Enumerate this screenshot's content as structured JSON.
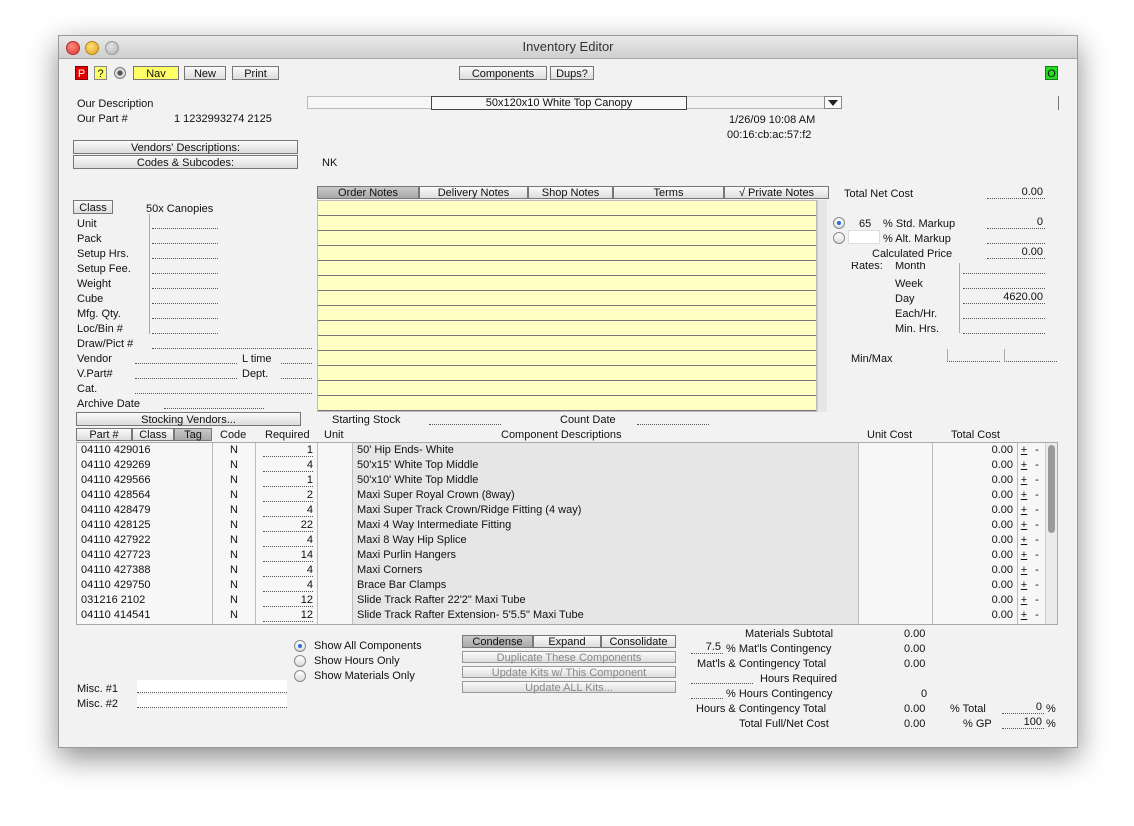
{
  "window": {
    "title": "Inventory Editor"
  },
  "toolbar": {
    "p": "P",
    "q": "?",
    "nav": "Nav",
    "new": "New",
    "print": "Print",
    "components": "Components",
    "dups": "Dups?",
    "status": "O"
  },
  "header": {
    "our_description_label": "Our Description",
    "our_part_label": "Our Part #",
    "our_part_value": "1 1232993274 2125",
    "description_value": "50x120x10 White Top Canopy",
    "date": "1/26/09 10:08 AM",
    "mac": "00:16:cb:ac:57:f2",
    "vendors_desc_button": "Vendors' Descriptions:",
    "codes_button": "Codes & Subcodes:",
    "codes_value": "NK"
  },
  "left": {
    "class_button": "Class",
    "class_value": "50x Canopies",
    "unit": "Unit",
    "pack": "Pack",
    "setup_hrs": "Setup Hrs.",
    "setup_fee": "Setup Fee.",
    "weight": "Weight",
    "cube": "Cube",
    "mfg_qty": "Mfg. Qty.",
    "loc_bin": "Loc/Bin #",
    "draw_pict": "Draw/Pict #",
    "vendor": "Vendor",
    "l_time": "L time",
    "v_part": "V.Part#",
    "dept": "Dept.",
    "cat": "Cat.",
    "archive_date": "Archive Date",
    "stocking_vendors": "Stocking Vendors..."
  },
  "notes": {
    "tabs": [
      "Order Notes",
      "Delivery Notes",
      "Shop Notes",
      "Terms",
      "√ Private Notes"
    ],
    "starting_stock": "Starting Stock",
    "count_date": "Count Date"
  },
  "pricing": {
    "total_net_cost_label": "Total Net Cost",
    "total_net_cost": "0.00",
    "std_markup_pct": "65",
    "std_markup_label": "% Std. Markup",
    "std_markup_value": "0",
    "alt_markup_label": "% Alt. Markup",
    "calc_price_label": "Calculated Price",
    "calc_price": "0.00",
    "rates_label": "Rates:",
    "month": "Month",
    "week": "Week",
    "day": "Day",
    "day_value": "4620.00",
    "each_hr": "Each/Hr.",
    "min_hrs": "Min. Hrs.",
    "min_max": "Min/Max"
  },
  "table": {
    "headers": {
      "part": "Part #",
      "class": "Class",
      "tag": "Tag",
      "code": "Code",
      "required": "Required",
      "unit": "Unit",
      "desc": "Component Descriptions",
      "unit_cost": "Unit Cost",
      "total_cost": "Total Cost"
    },
    "rows": [
      {
        "part": "04110 429016",
        "code": "N",
        "required": "1",
        "desc": "50' Hip Ends- White",
        "total": "0.00"
      },
      {
        "part": "04110 429269",
        "code": "N",
        "required": "4",
        "desc": "50'x15' White Top Middle",
        "total": "0.00"
      },
      {
        "part": "04110 429566",
        "code": "N",
        "required": "1",
        "desc": "50'x10' White Top Middle",
        "total": "0.00"
      },
      {
        "part": "04110 428564",
        "code": "N",
        "required": "2",
        "desc": "Maxi Super Royal Crown (8way)",
        "total": "0.00"
      },
      {
        "part": "04110 428479",
        "code": "N",
        "required": "4",
        "desc": "Maxi Super Track Crown/Ridge Fitting (4 way)",
        "total": "0.00"
      },
      {
        "part": "04110 428125",
        "code": "N",
        "required": "22",
        "desc": "Maxi 4 Way Intermediate Fitting",
        "total": "0.00"
      },
      {
        "part": "04110 427922",
        "code": "N",
        "required": "4",
        "desc": "Maxi 8 Way Hip Splice",
        "total": "0.00"
      },
      {
        "part": "04110 427723",
        "code": "N",
        "required": "14",
        "desc": "Maxi Purlin Hangers",
        "total": "0.00"
      },
      {
        "part": "04110 427388",
        "code": "N",
        "required": "4",
        "desc": "Maxi Corners",
        "total": "0.00"
      },
      {
        "part": "04110 429750",
        "code": "N",
        "required": "4",
        "desc": "Brace Bar Clamps",
        "total": "0.00"
      },
      {
        "part": "031216 2102",
        "code": "N",
        "required": "12",
        "desc": "Slide Track Rafter 22'2\" Maxi Tube",
        "total": "0.00"
      },
      {
        "part": "04110 414541",
        "code": "N",
        "required": "12",
        "desc": "Slide Track Rafter Extension- 5'5.5\" Maxi Tube",
        "total": "0.00"
      }
    ],
    "plus": "+",
    "minus": "-"
  },
  "bottom": {
    "show_all": "Show All Components",
    "show_hours": "Show Hours Only",
    "show_materials": "Show Materials Only",
    "condense": "Condense",
    "expand": "Expand",
    "consolidate": "Consolidate",
    "duplicate": "Duplicate These Components",
    "update_kits": "Update Kits w/ This Component",
    "update_all": "Update ALL Kits...",
    "misc1": "Misc. #1",
    "misc2": "Misc. #2"
  },
  "totals": {
    "materials_subtotal_label": "Materials Subtotal",
    "materials_subtotal": "0.00",
    "mat_contingency_pct": "7.5",
    "mat_contingency_label": "% Mat'ls Contingency",
    "mat_contingency": "0.00",
    "mat_contingency_total_label": "Mat'ls & Contingency Total",
    "mat_contingency_total": "0.00",
    "hours_required_label": "Hours Required",
    "hours_contingency_label": "% Hours Contingency",
    "hours_contingency": "0",
    "hours_contingency_total_label": "Hours & Contingency Total",
    "hours_contingency_total": "0.00",
    "total_full_net_label": "Total Full/Net Cost",
    "total_full_net": "0.00",
    "pct_total_label": "% Total",
    "pct_total": "0",
    "pct_gp_label": "% GP",
    "pct_gp": "100",
    "pct_sign": "%"
  }
}
